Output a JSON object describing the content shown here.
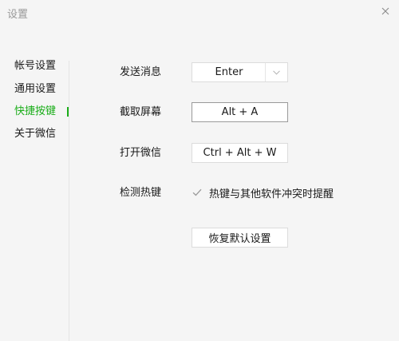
{
  "window": {
    "title": "设置",
    "close_icon": "close-icon"
  },
  "sidebar": {
    "items": [
      {
        "label": "帐号设置",
        "active": false
      },
      {
        "label": "通用设置",
        "active": false
      },
      {
        "label": "快捷按键",
        "active": true
      },
      {
        "label": "关于微信",
        "active": false
      }
    ],
    "active_color": "#1aad19"
  },
  "shortcuts": {
    "send_message": {
      "label": "发送消息",
      "value": "Enter",
      "icon": "chevron-down-icon"
    },
    "screenshot": {
      "label": "截取屏幕",
      "value": "Alt + A"
    },
    "open_wechat": {
      "label": "打开微信",
      "value": "Ctrl + Alt + W"
    },
    "detect_hotkeys": {
      "label": "检测热键",
      "checkbox_label": "热键与其他软件冲突时提醒",
      "checked": true,
      "icon": "checkmark-icon"
    }
  },
  "reset_button": {
    "label": "恢复默认设置"
  }
}
